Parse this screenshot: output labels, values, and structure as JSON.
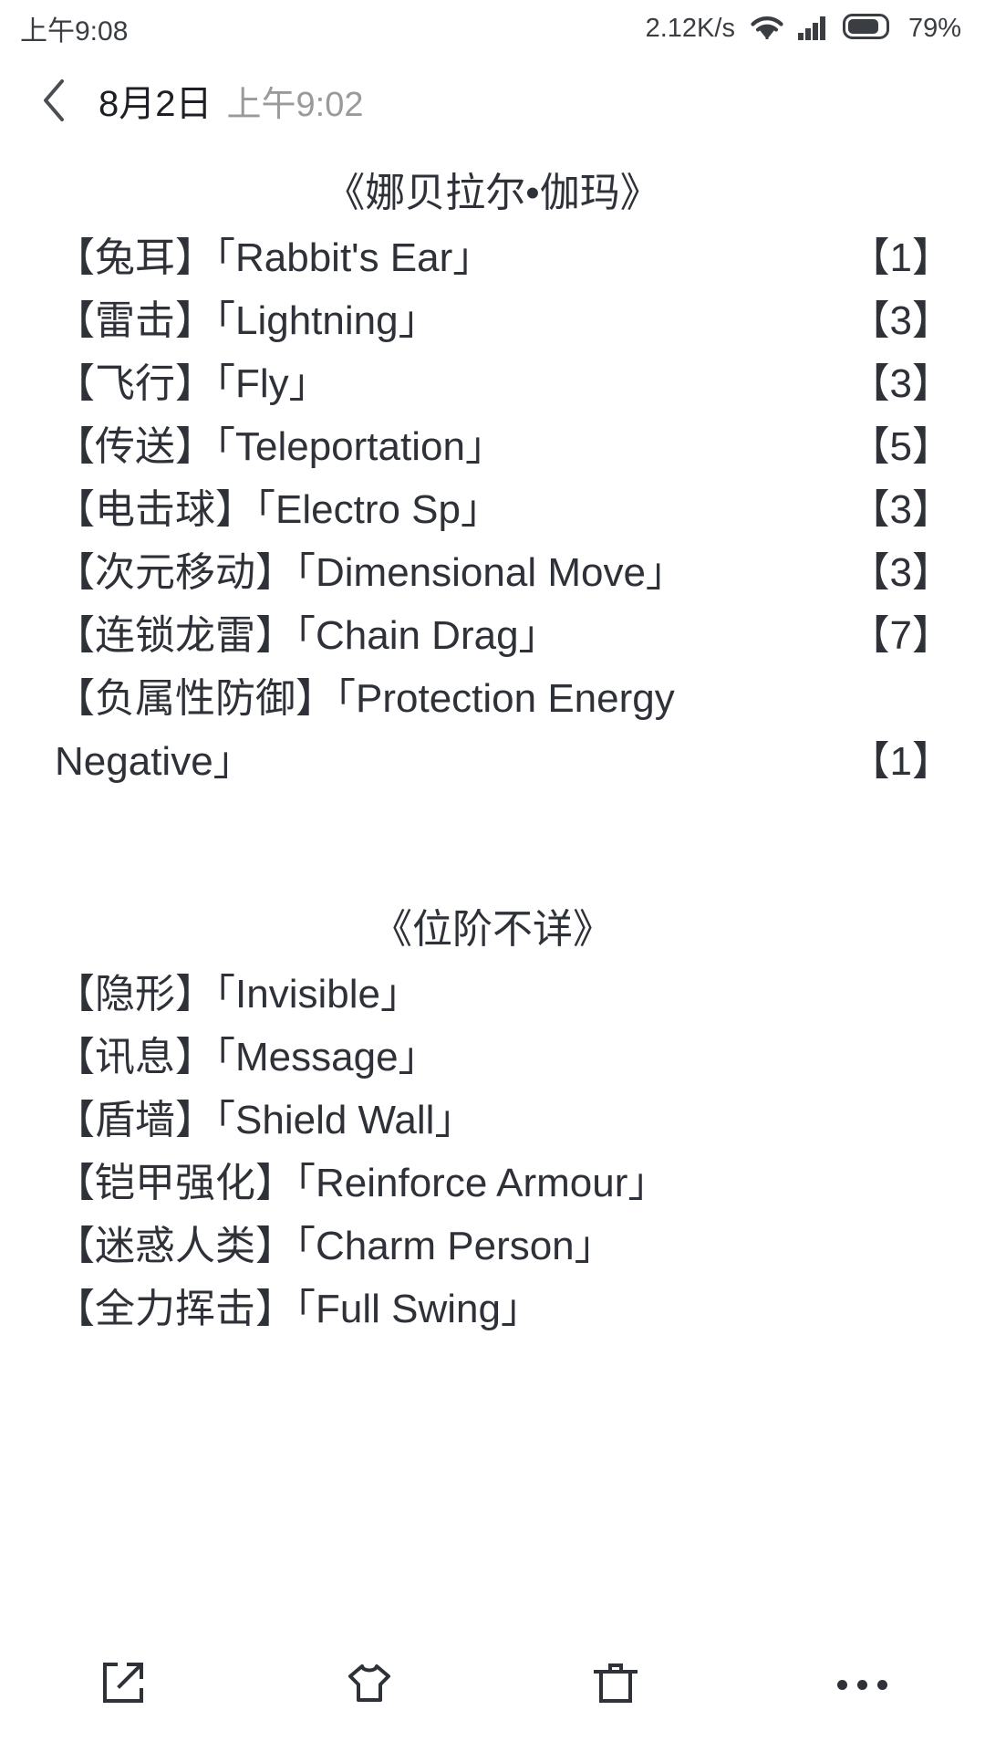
{
  "status_bar": {
    "time": "上午9:08",
    "network_speed": "2.12K/s",
    "battery_percent": "79%",
    "icons": [
      "wifi-icon",
      "cellular-signal-icon",
      "battery-icon"
    ]
  },
  "header": {
    "back_icon": "back-chevron-icon",
    "date": "8月2日",
    "time": "上午9:02"
  },
  "note": {
    "sections": [
      {
        "title": "《娜贝拉尔•伽玛》",
        "rows": [
          {
            "label": "【兔耳】「Rabbit's Ear」",
            "level": "【1】"
          },
          {
            "label": "【雷击】「Lightning」",
            "level": "【3】"
          },
          {
            "label": "【飞行】「Fly」",
            "level": "【3】"
          },
          {
            "label": "【传送】「Teleportation」",
            "level": "【5】"
          },
          {
            "label": "【电击球】「Electro Sp」",
            "level": "【3】"
          },
          {
            "label": "【次元移动】「Dimensional Move」",
            "level": "【3】"
          },
          {
            "label": "【连锁龙雷】「Chain Drag」",
            "level": "【7】"
          },
          {
            "label": "【负属性防御】「Protection Energy Negative」",
            "level": "【1】",
            "wrapped": true
          }
        ]
      },
      {
        "title": "《位阶不详》",
        "rows": [
          {
            "label": "【隐形】「Invisible」",
            "level": ""
          },
          {
            "label": "【讯息】「Message」",
            "level": ""
          },
          {
            "label": "【盾墙】「Shield Wall」",
            "level": ""
          },
          {
            "label": "【铠甲强化】「Reinforce Armour」",
            "level": ""
          },
          {
            "label": "【迷惑人类】「Charm Person」",
            "level": ""
          },
          {
            "label": "【全力挥击】「Full Swing」",
            "level": ""
          }
        ]
      }
    ]
  },
  "toolbar": {
    "items": [
      {
        "name": "share-icon",
        "label": "分享"
      },
      {
        "name": "tshirt-skin-icon",
        "label": "皮肤"
      },
      {
        "name": "trash-icon",
        "label": "删除"
      },
      {
        "name": "more-icon",
        "label": "更多"
      }
    ]
  },
  "colors": {
    "text": "#2e3138",
    "muted": "#9a9a9a",
    "background": "#ffffff"
  }
}
